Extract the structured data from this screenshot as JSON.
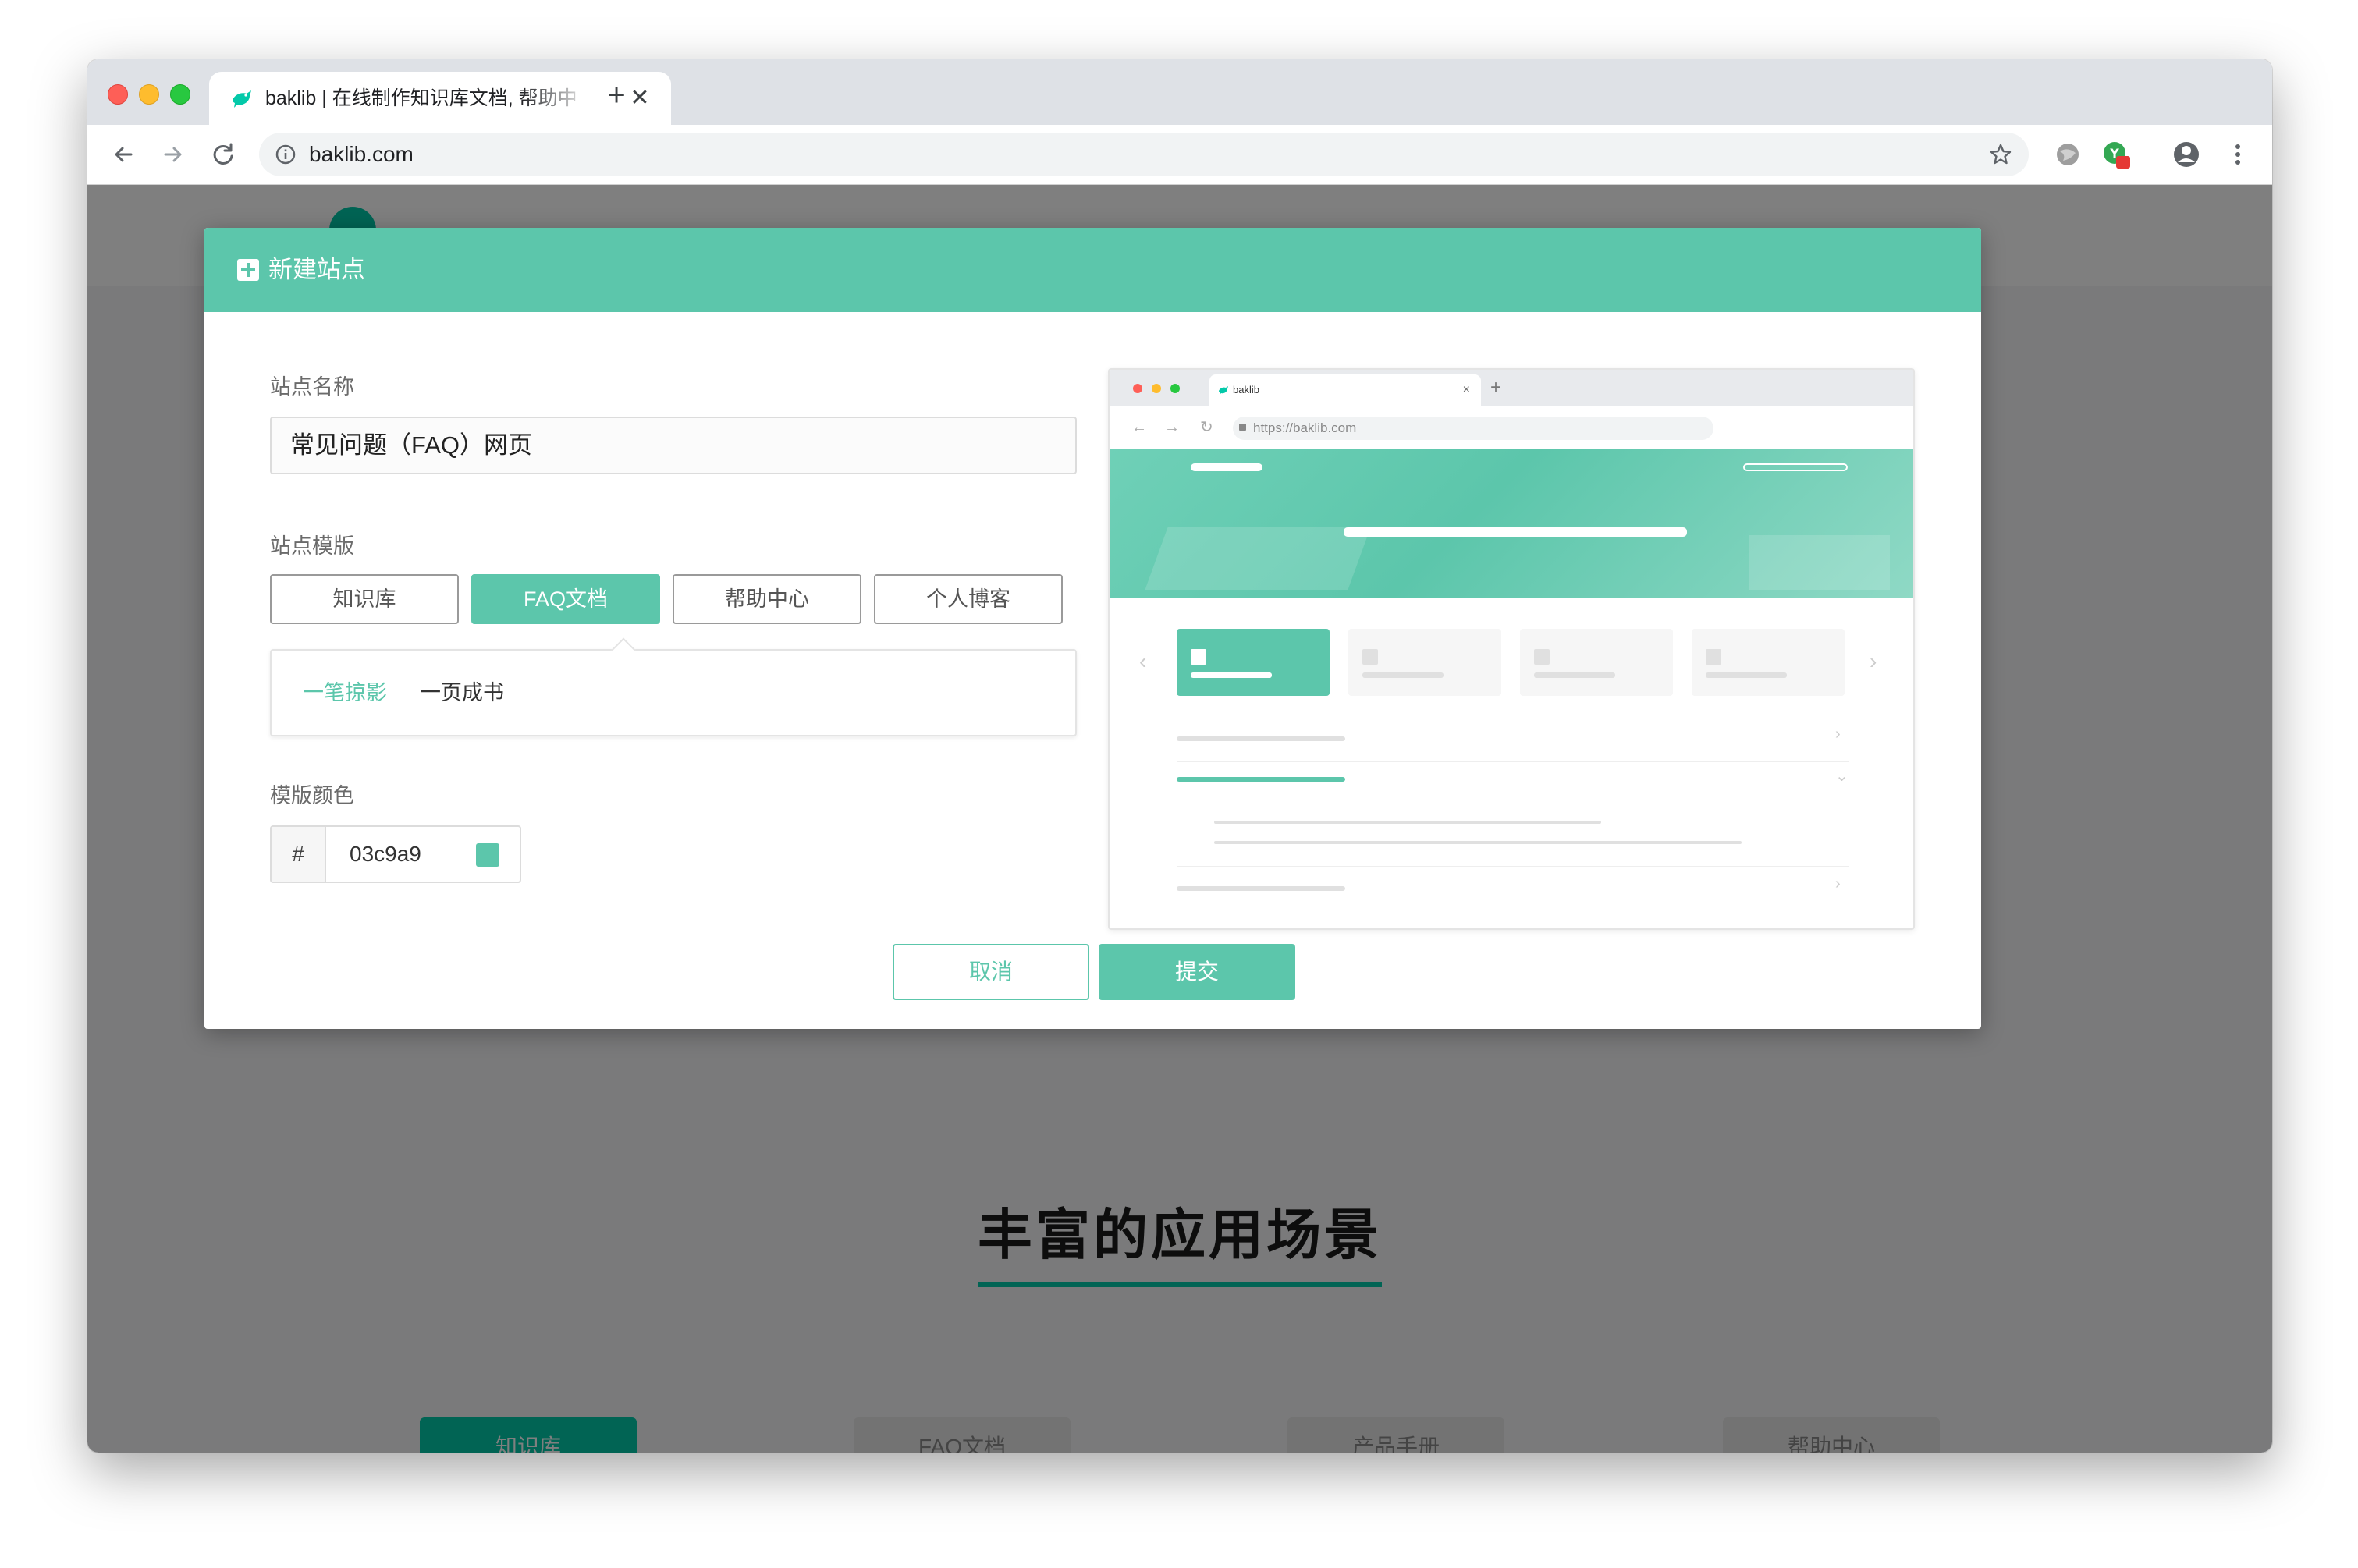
{
  "browser": {
    "tab_title": "baklib | 在线制作知识库文档, 帮助中心",
    "url": "baklib.com",
    "close_symbol": "✕",
    "new_tab_symbol": "+"
  },
  "background_page": {
    "heading": "丰富的应用场景",
    "scene_tabs": [
      "知识库",
      "FAQ文档",
      "产品手册",
      "帮助中心"
    ]
  },
  "modal": {
    "title": "新建站点",
    "site_name_label": "站点名称",
    "site_name_value": "常见问题（FAQ）网页",
    "template_label": "站点模版",
    "templates": [
      "知识库",
      "FAQ文档",
      "帮助中心",
      "个人博客"
    ],
    "selected_template": "FAQ文档",
    "sub_options": [
      "一笔掠影",
      "一页成书"
    ],
    "selected_sub_option": "一笔掠影",
    "color_label": "模版颜色",
    "color_prefix": "#",
    "color_value": "03c9a9",
    "cancel_label": "取消",
    "submit_label": "提交"
  },
  "preview": {
    "tab_text": "baklib",
    "close_symbol": "×",
    "new_tab_symbol": "+",
    "url": "https://baklib.com"
  },
  "colors": {
    "accent": "#5cc6ab",
    "template_color": "#03c9a9"
  },
  "icons": [
    "bird-logo-icon",
    "back-arrow-icon",
    "forward-arrow-icon",
    "reload-icon",
    "info-icon",
    "star-icon",
    "globe-extension-icon",
    "translate-extension-icon",
    "profile-icon",
    "menu-dots-icon",
    "plus-square-icon",
    "lock-icon"
  ]
}
